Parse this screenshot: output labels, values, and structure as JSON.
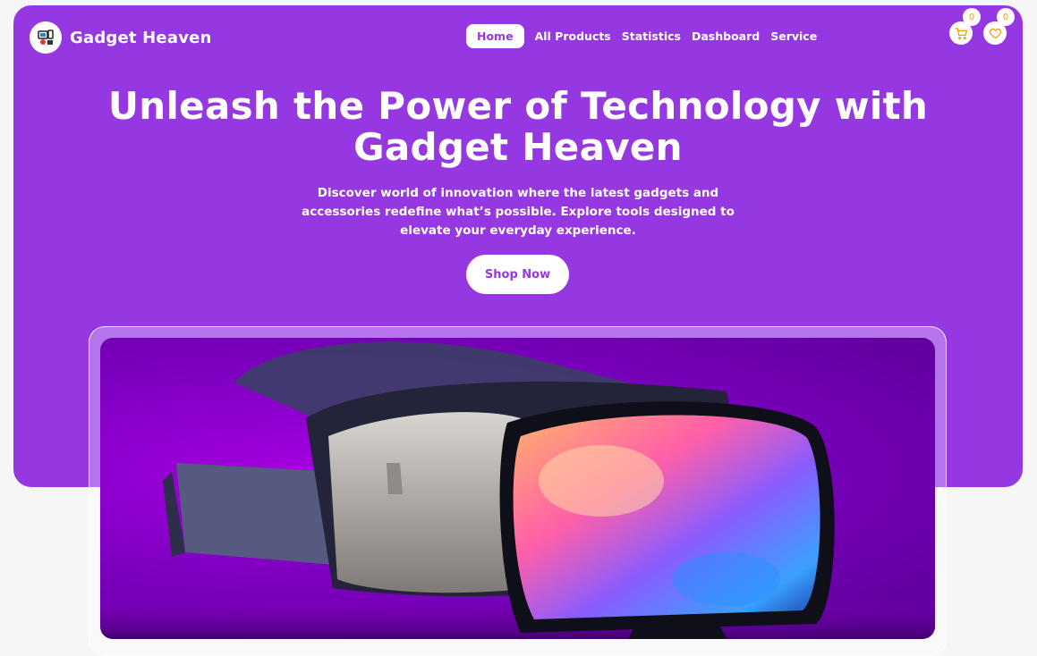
{
  "brand": {
    "name": "Gadget Heaven",
    "logo_icon": "gadget-logo-icon"
  },
  "nav": {
    "links": [
      {
        "label": "Home",
        "active": true
      },
      {
        "label": "All Products",
        "active": false
      },
      {
        "label": "Statistics",
        "active": false
      },
      {
        "label": "Dashboard",
        "active": false
      },
      {
        "label": "Service",
        "active": false
      }
    ],
    "cart": {
      "icon": "cart-icon",
      "count": "0"
    },
    "wishlist": {
      "icon": "heart-icon",
      "count": "0"
    }
  },
  "hero": {
    "headline_line1": "Unleash the Power of Technology with",
    "headline_line2": "Gadget Heaven",
    "subtext": "Discover world of innovation where the latest gadgets and accessories redefine what’s possible. Explore tools designed to elevate your everyday experience.",
    "cta_label": "Shop Now",
    "banner_image": "vr-headset-image"
  },
  "colors": {
    "primary": "#9538e2",
    "accent": "#f39c12",
    "background": "#f6f6f6"
  }
}
